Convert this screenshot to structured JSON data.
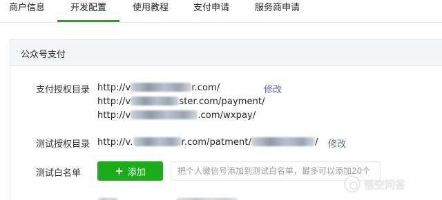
{
  "tabs": [
    {
      "label": "商户信息",
      "active": false
    },
    {
      "label": "开发配置",
      "active": true
    },
    {
      "label": "使用教程",
      "active": false
    },
    {
      "label": "支付申请",
      "active": false
    },
    {
      "label": "服务商申请",
      "active": false
    }
  ],
  "panel": {
    "title": "公众号支付",
    "pay_auth": {
      "label": "支付授权目录",
      "urls": [
        {
          "prefix": "http://v",
          "suffix": "r.com/"
        },
        {
          "prefix": "http://v",
          "suffix": "ster.com/payment/"
        },
        {
          "prefix": "http://v",
          "suffix": ".com/wxpay/"
        }
      ],
      "edit_label": "修改"
    },
    "test_auth": {
      "label": "测试授权目录",
      "url_prefix": "http://v.",
      "url_middle": "r.com/patment/",
      "url_suffix": "/",
      "edit_label": "修改"
    },
    "whitelist": {
      "label": "测试白名单",
      "add_label": "添加",
      "input_placeholder": "把个人微信号添加到测试白名单，最多可以添加20个"
    }
  },
  "watermark": {
    "text": "悟空问答"
  },
  "colors": {
    "accent": "#1aad19",
    "link": "#576b95",
    "header_bg": "#f4f5f9",
    "border": "#e7e7eb"
  }
}
